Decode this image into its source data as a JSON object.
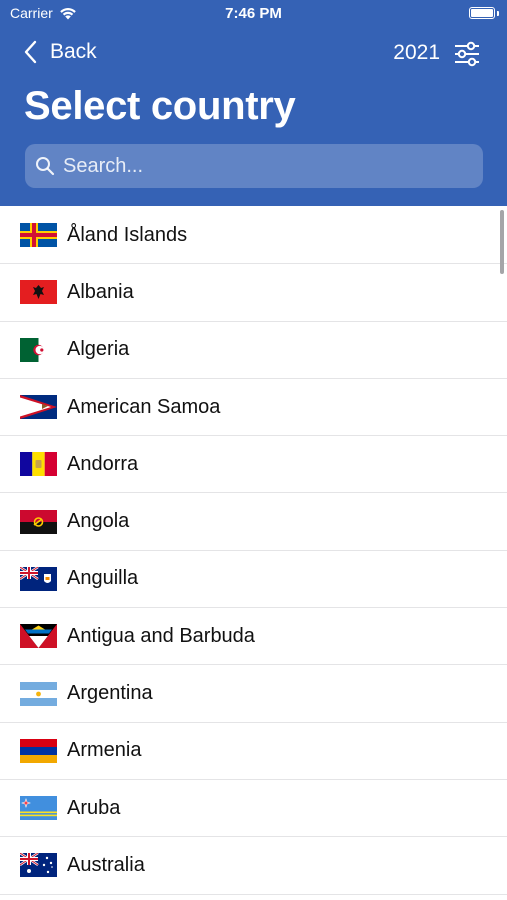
{
  "status_bar": {
    "carrier": "Carrier",
    "time": "7:46 PM"
  },
  "nav": {
    "back_label": "Back",
    "year": "2021"
  },
  "title": "Select country",
  "search": {
    "placeholder": "Search...",
    "value": ""
  },
  "countries": [
    {
      "name": "Åland Islands",
      "flag": "flag-aland-islands"
    },
    {
      "name": "Albania",
      "flag": "flag-albania"
    },
    {
      "name": "Algeria",
      "flag": "flag-algeria"
    },
    {
      "name": "American Samoa",
      "flag": "flag-american-samoa"
    },
    {
      "name": "Andorra",
      "flag": "flag-andorra"
    },
    {
      "name": "Angola",
      "flag": "flag-angola"
    },
    {
      "name": "Anguilla",
      "flag": "flag-anguilla"
    },
    {
      "name": "Antigua and Barbuda",
      "flag": "flag-antigua-and-barbuda"
    },
    {
      "name": "Argentina",
      "flag": "flag-argentina"
    },
    {
      "name": "Armenia",
      "flag": "flag-armenia"
    },
    {
      "name": "Aruba",
      "flag": "flag-aruba"
    },
    {
      "name": "Australia",
      "flag": "flag-australia"
    }
  ],
  "colors": {
    "header": "#3562b5",
    "separator": "#e4e4e6",
    "text": "#111111"
  }
}
